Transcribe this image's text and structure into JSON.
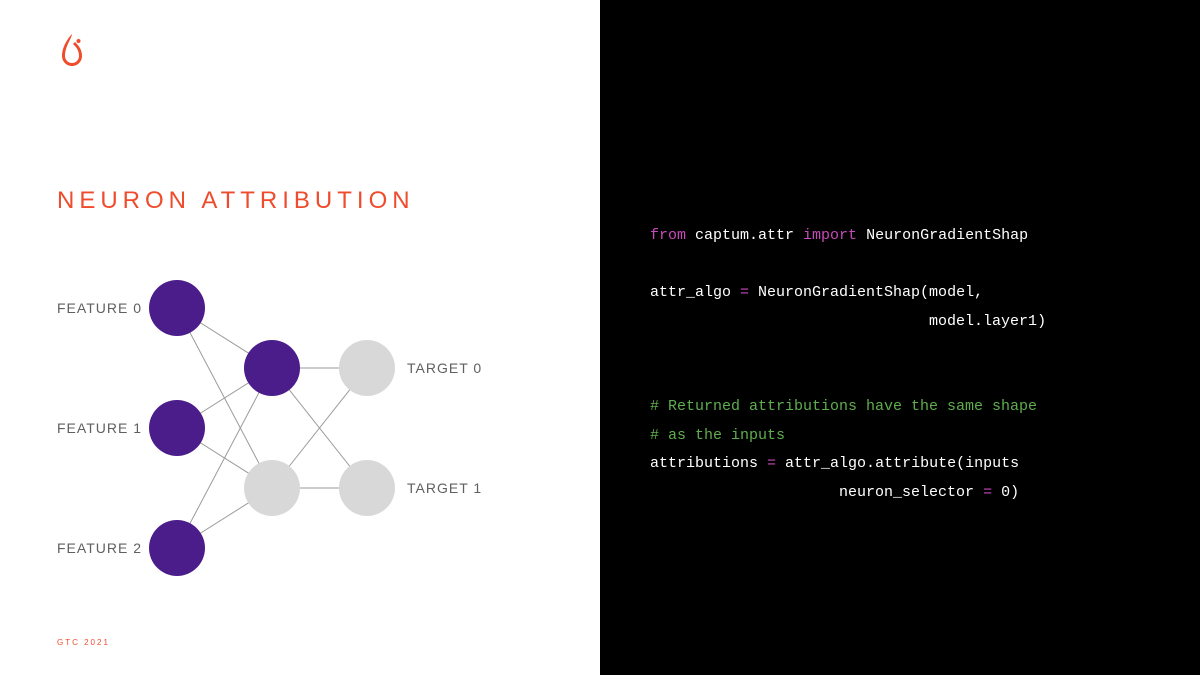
{
  "title": "NEURON ATTRIBUTION",
  "footer": "GTC 2021",
  "labels": {
    "feature0": "FEATURE 0",
    "feature1": "FEATURE 1",
    "feature2": "FEATURE 2",
    "target0": "TARGET 0",
    "target1": "TARGET 1"
  },
  "colors": {
    "accent": "#ee4c2c",
    "node_active": "#4a1d8a",
    "node_inactive": "#d8d8d8",
    "edge": "#9a9a9a"
  },
  "network": {
    "layers": [
      {
        "count": 3,
        "active": [
          true,
          true,
          true
        ]
      },
      {
        "count": 2,
        "active": [
          true,
          false
        ]
      },
      {
        "count": 2,
        "active": [
          false,
          false
        ]
      }
    ],
    "node_radius": 28
  },
  "code": {
    "kw_from": "from",
    "mod": " captum.attr ",
    "kw_import": "import",
    "cls": " NeuronGradientShap",
    "l3a": "attr_algo ",
    "eq": "=",
    "l3b": " NeuronGradientShap(model,",
    "l4": "                               model.layer1)",
    "c1": "# Returned attributions have the same shape",
    "c2": "# as the inputs",
    "l8a": "attributions ",
    "l8b": " attr_algo.attribute(inputs",
    "l9": "                     neuron_selector ",
    "l9b": " 0)"
  }
}
